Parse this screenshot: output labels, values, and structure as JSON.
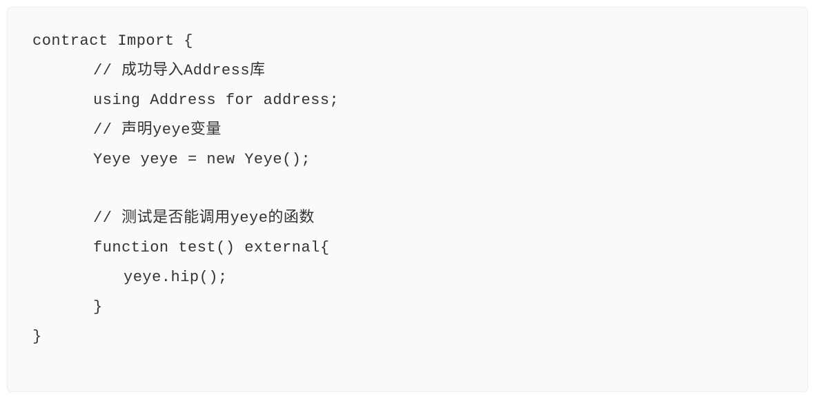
{
  "code": {
    "lines": [
      {
        "text": "contract Import {",
        "indent": 0
      },
      {
        "text": "// 成功导入Address库",
        "indent": 1
      },
      {
        "text": "using Address for address;",
        "indent": 1
      },
      {
        "text": "// 声明yeye变量",
        "indent": 1
      },
      {
        "text": "Yeye yeye = new Yeye();",
        "indent": 1
      },
      {
        "text": "",
        "indent": 1
      },
      {
        "text": "// 测试是否能调用yeye的函数",
        "indent": 1
      },
      {
        "text": "function test() external{",
        "indent": 1
      },
      {
        "text": "yeye.hip();",
        "indent": 2
      },
      {
        "text": "}",
        "indent": 1
      },
      {
        "text": "}",
        "indent": 0
      }
    ]
  }
}
